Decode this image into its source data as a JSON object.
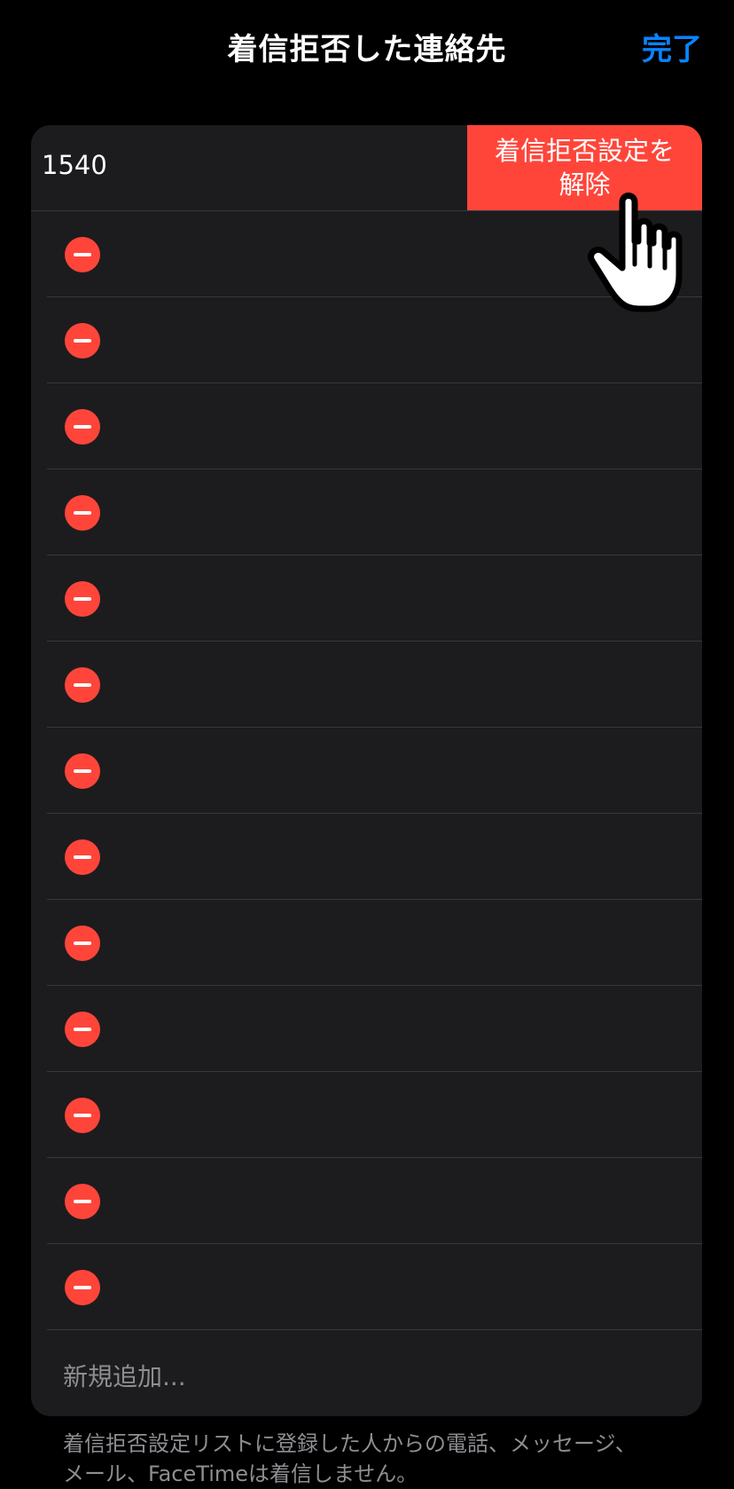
{
  "nav": {
    "title": "着信拒否した連絡先",
    "done_label": "完了"
  },
  "blocked_list": {
    "first_entry": {
      "number": "1540",
      "unblock_label_line1": "着信拒否設定を",
      "unblock_label_line2": "解除"
    },
    "remove_rows_count": 13,
    "add_new_label": "新規追加..."
  },
  "footer": {
    "note_line1": "着信拒否設定リストに登録した人からの電話、メッセージ、",
    "note_line2": "メール、FaceTimeは着信しません。"
  },
  "colors": {
    "background": "#000000",
    "card": "#1c1c1e",
    "accent_blue": "#0a84ff",
    "destructive_red": "#ff453a",
    "secondary_text": "#8e8e93"
  },
  "icons": {
    "remove": "minus-circle-icon",
    "pointer": "pointing-hand-icon"
  }
}
